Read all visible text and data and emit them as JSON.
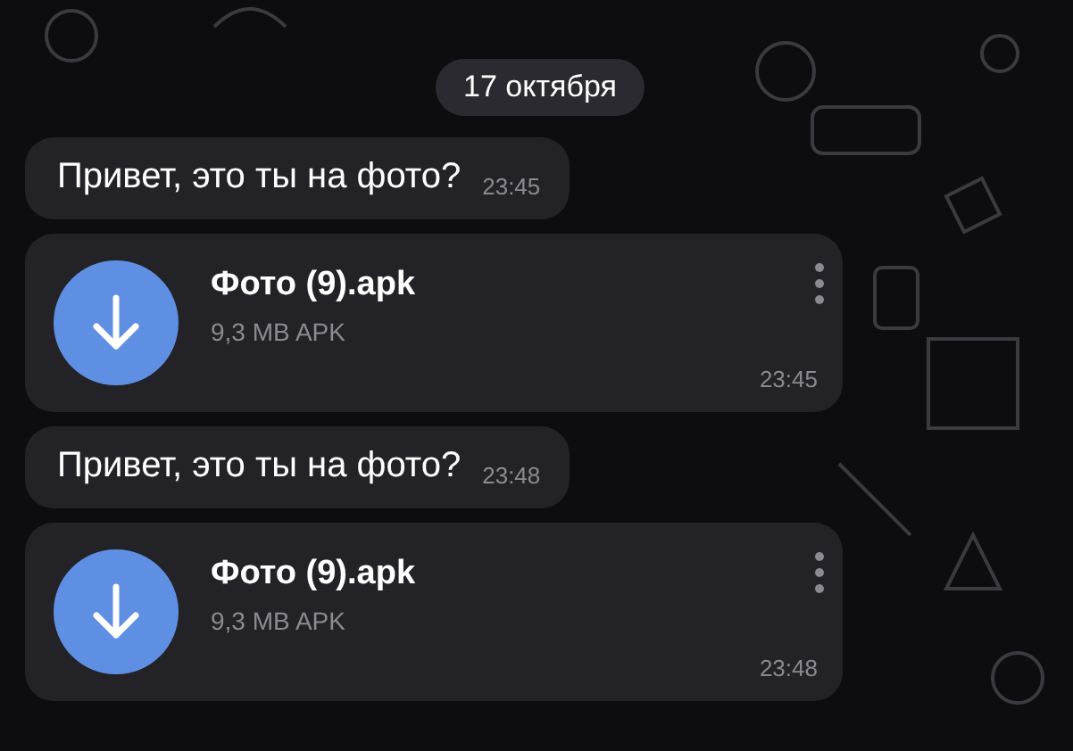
{
  "date_badge": "17 октября",
  "messages": [
    {
      "kind": "text",
      "text": "Привет, это ты на фото?",
      "time": "23:45"
    },
    {
      "kind": "file",
      "file_name": "Фото (9).apk",
      "file_info": "9,3 MB APK",
      "time": "23:45"
    },
    {
      "kind": "text",
      "text": "Привет, это ты на фото?",
      "time": "23:48"
    },
    {
      "kind": "file",
      "file_name": "Фото (9).apk",
      "file_info": "9,3 MB APK",
      "time": "23:48"
    }
  ]
}
